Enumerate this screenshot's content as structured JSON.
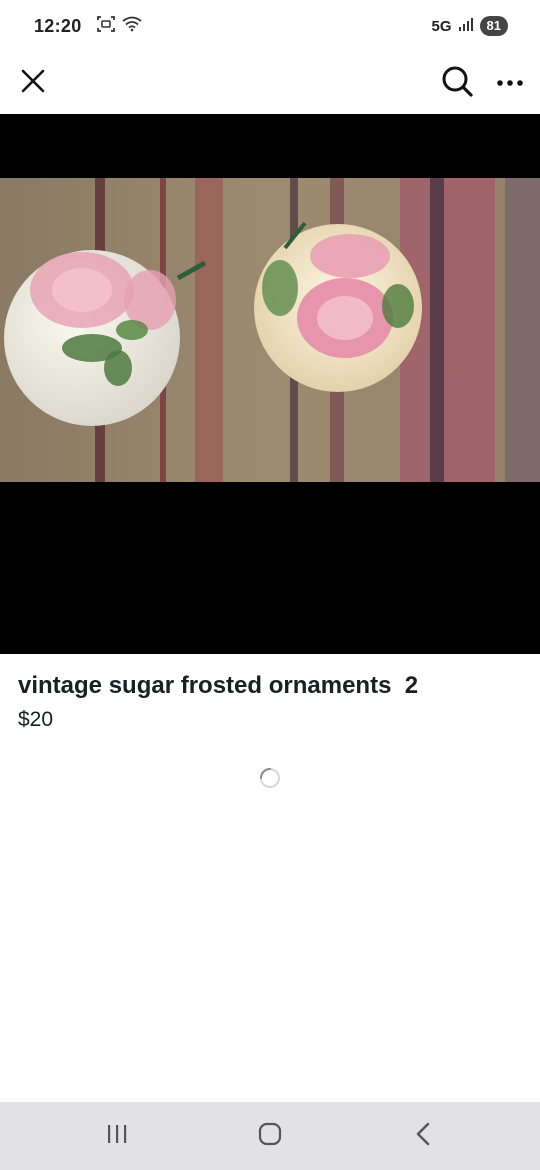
{
  "status_bar": {
    "time": "12:20",
    "network": "5G",
    "battery": "81",
    "icons": [
      "screenshot-icon",
      "wifi-icon",
      "signal-icon"
    ]
  },
  "top_bar": {
    "icons": [
      "close-icon",
      "search-icon",
      "more-options-icon"
    ]
  },
  "listing": {
    "title": "vintage sugar frosted ornaments  2",
    "price": "$20"
  },
  "nav_bar": {
    "icons": [
      "recent-apps-icon",
      "home-icon",
      "back-icon"
    ]
  },
  "colors": {
    "photo_background": "#000000",
    "nav_background": "#e2e2e4",
    "text": "#1c1e21"
  }
}
